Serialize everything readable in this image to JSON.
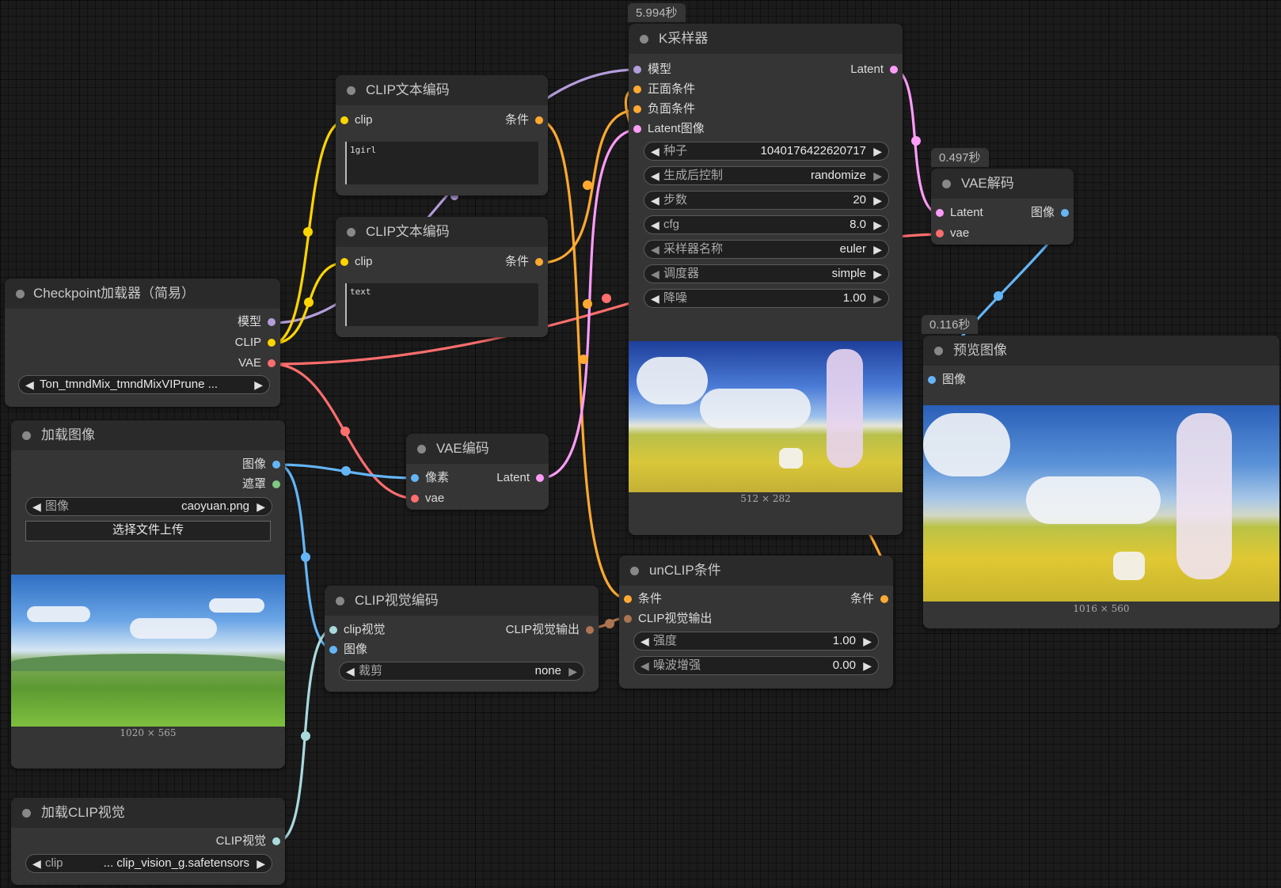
{
  "colors": {
    "model": "#b39ddb",
    "clip": "#ffd500",
    "vae": "#ff6e6e",
    "conditioning": "#ffa931",
    "latent": "#ff9cf9",
    "image": "#64b5f6",
    "mask": "#81c784",
    "clip_vision": "#a8dadc",
    "clip_vision_output": "#ad7452"
  },
  "timings": {
    "ksampler": "5.994秒",
    "vae_decode": "0.497秒",
    "preview": "0.116秒"
  },
  "checkpoint": {
    "title": "Checkpoint加载器（简易）",
    "outputs": [
      "模型",
      "CLIP",
      "VAE"
    ],
    "ckpt_value": "Ton_tmndMix_tmndMixVIPrune ..."
  },
  "clip_text_1": {
    "title": "CLIP文本编码",
    "input": "clip",
    "output": "条件",
    "text": "1girl"
  },
  "clip_text_2": {
    "title": "CLIP文本编码",
    "input": "clip",
    "output": "条件",
    "text": "text"
  },
  "load_image": {
    "title": "加载图像",
    "outputs": [
      "图像",
      "遮罩"
    ],
    "image_label": "图像",
    "image_value": "caoyuan.png",
    "upload_label": "选择文件上传",
    "caption": "1020 × 565"
  },
  "vae_encode": {
    "title": "VAE编码",
    "inputs": [
      "像素",
      "vae"
    ],
    "output": "Latent"
  },
  "load_clip_vision": {
    "title": "加载CLIP视觉",
    "output": "CLIP视觉",
    "widget_label": "clip",
    "widget_value": "... clip_vision_g.safetensors"
  },
  "clip_vision_encode": {
    "title": "CLIP视觉编码",
    "inputs": [
      "clip视觉",
      "图像"
    ],
    "output": "CLIP视觉输出",
    "crop_label": "裁剪",
    "crop_value": "none"
  },
  "ksampler": {
    "title": "K采样器",
    "inputs": [
      "模型",
      "正面条件",
      "负面条件",
      "Latent图像"
    ],
    "output": "Latent",
    "widgets": [
      {
        "label": "种子",
        "value": "1040176422620717"
      },
      {
        "label": "生成后控制",
        "value": "randomize"
      },
      {
        "label": "步数",
        "value": "20"
      },
      {
        "label": "cfg",
        "value": "8.0"
      },
      {
        "label": "采样器名称",
        "value": "euler"
      },
      {
        "label": "调度器",
        "value": "simple"
      },
      {
        "label": "降噪",
        "value": "1.00"
      }
    ],
    "caption": "512 × 282"
  },
  "unclip": {
    "title": "unCLIP条件",
    "inputs": [
      "条件",
      "CLIP视觉输出"
    ],
    "output": "条件",
    "widgets": [
      {
        "label": "强度",
        "value": "1.00"
      },
      {
        "label": "噪波增强",
        "value": "0.00"
      }
    ]
  },
  "vae_decode": {
    "title": "VAE解码",
    "inputs": [
      "Latent",
      "vae"
    ],
    "output": "图像"
  },
  "preview": {
    "title": "预览图像",
    "input": "图像",
    "caption": "1016 × 560"
  }
}
